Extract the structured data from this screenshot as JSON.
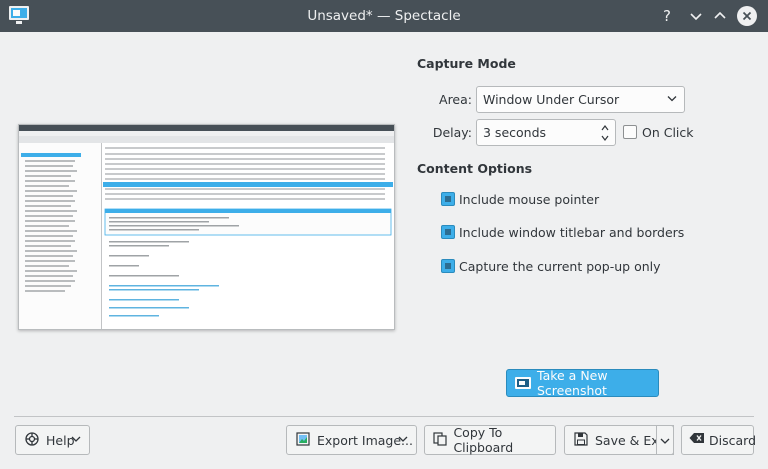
{
  "window": {
    "title": "Unsaved* — Spectacle",
    "controls": [
      "help",
      "minimize",
      "maximize",
      "close"
    ]
  },
  "capture_mode": {
    "heading": "Capture Mode",
    "area_label": "Area:",
    "area_value": "Window Under Cursor",
    "delay_label": "Delay:",
    "delay_value": "3 seconds",
    "on_click_label": "On Click",
    "on_click_checked": false
  },
  "content_options": {
    "heading": "Content Options",
    "options": [
      {
        "label": "Include mouse pointer",
        "checked": true
      },
      {
        "label": "Include window titlebar and borders",
        "checked": true
      },
      {
        "label": "Capture the current pop-up only",
        "checked": true
      }
    ]
  },
  "actions": {
    "take_screenshot": "Take a New Screenshot",
    "help": "Help",
    "export": "Export Image...",
    "copy": "Copy To Clipboard",
    "save_exit": "Save & Exit",
    "discard": "Discard"
  },
  "colors": {
    "accent": "#3daee9",
    "titlebar": "#475057",
    "background": "#eff0f1"
  }
}
